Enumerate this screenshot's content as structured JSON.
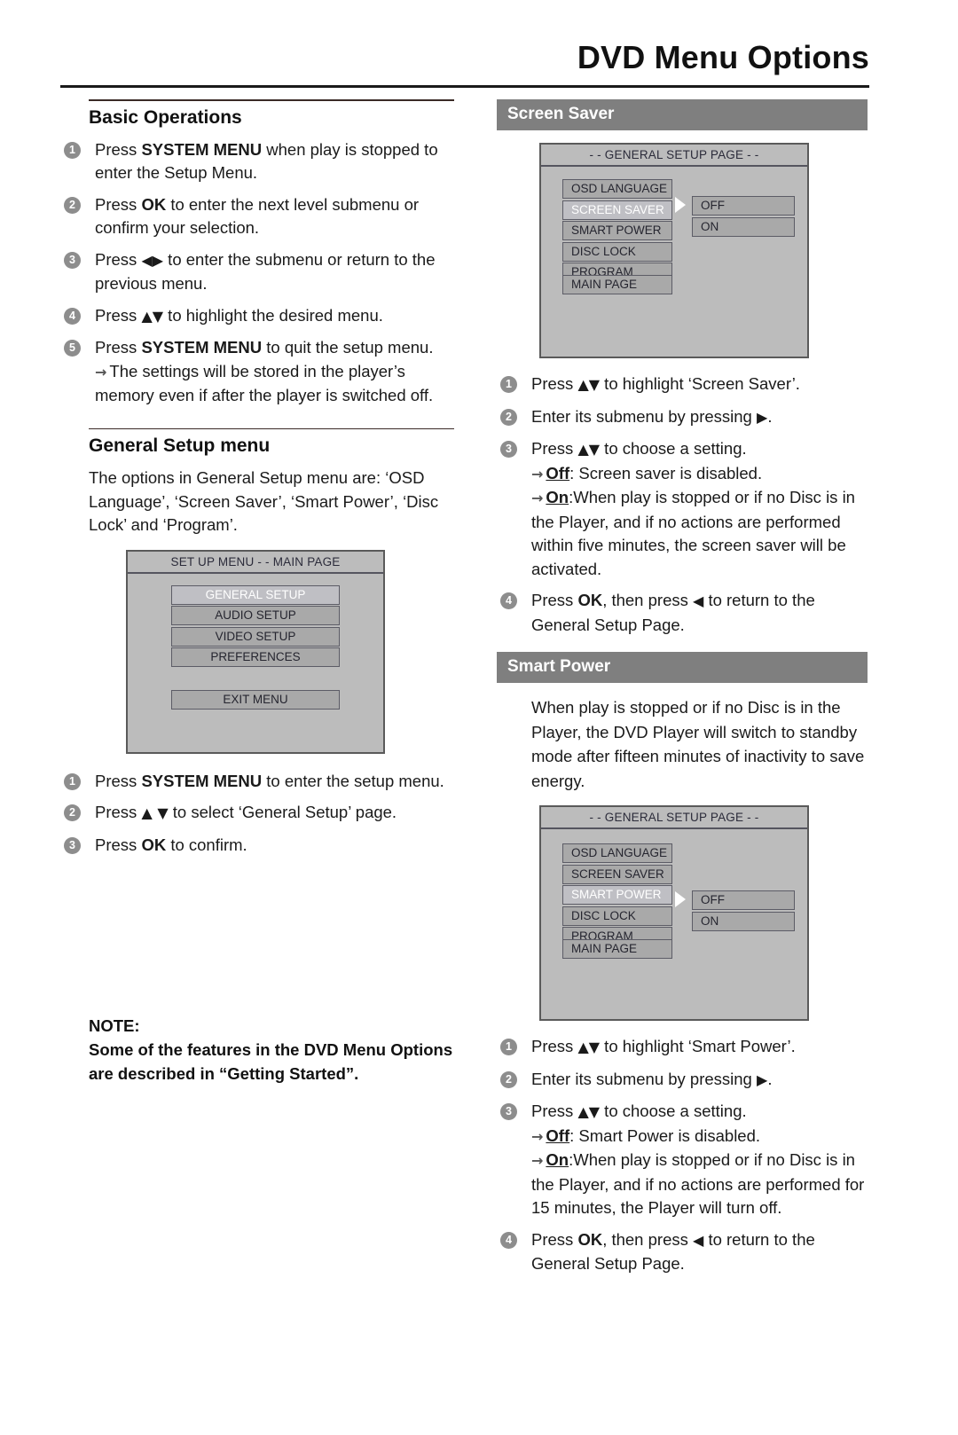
{
  "header": {
    "title": "DVD Menu Options"
  },
  "left": {
    "basic_ops": {
      "heading": "Basic Operations",
      "steps": [
        {
          "num": "1",
          "html_parts": [
            "Press ",
            "SYSTEM MENU",
            " when play is stopped to enter the Setup Menu."
          ]
        },
        {
          "num": "2",
          "html_parts": [
            "Press ",
            "OK",
            " to enter the next level submenu or confirm your selection."
          ]
        },
        {
          "num": "3",
          "html_parts": [
            "Press ",
            "◀▶",
            " to enter the submenu or return to the previous menu."
          ]
        },
        {
          "num": "4",
          "html_parts": [
            "Press ",
            "▲▼",
            " to highlight the desired menu."
          ]
        },
        {
          "num": "5",
          "html_parts": [
            "Press ",
            "SYSTEM MENU",
            " to quit the setup menu."
          ]
        }
      ],
      "step1_text_a": "Press ",
      "step1_bold": "SYSTEM MENU",
      "step1_text_b": " when play is stopped to enter the Setup Menu.",
      "step2_text_a": "Press ",
      "step2_bold": "OK",
      "step2_text_b": " to enter the next level submenu or confirm your selection.",
      "step3_text_a": "Press ",
      "step3_arrows": "◀▶",
      "step3_text_b": " to enter the submenu or return to the previous menu.",
      "step4_text_a": "Press ",
      "step4_arrows": "▲▼",
      "step4_text_b": " to highlight the desired menu.",
      "step5_text_a": "Press ",
      "step5_bold": "SYSTEM MENU",
      "step5_text_b": " to quit the setup menu.",
      "step5_sub": "The settings will be stored in the player’s memory even if after the player is switched off."
    },
    "general_setup": {
      "heading": "General Setup menu",
      "intro": "The options in General Setup menu are: ‘OSD Language’, ‘Screen Saver’, ‘Smart Power’, ‘Disc Lock’ and ‘Program’.",
      "steps": {
        "s1_a": "Press ",
        "s1_bold": "SYSTEM MENU",
        "s1_b": " to enter the setup menu.",
        "s2_a": "Press ",
        "s2_arrows": "▲ ▼",
        "s2_b": " to select ‘General Setup’ page.",
        "s3_a": "Press ",
        "s3_bold": "OK",
        "s3_b": " to confirm."
      }
    },
    "osd_main": {
      "title": "SET UP MENU - - MAIN PAGE",
      "items": [
        "GENERAL SETUP",
        "AUDIO SETUP",
        "VIDEO SETUP",
        "PREFERENCES"
      ],
      "selected_index": 0,
      "exit_label": "EXIT MENU"
    },
    "note": {
      "label": "NOTE:",
      "body": "Some of the features in the DVD Menu Options are described in “Getting Started”."
    }
  },
  "right": {
    "screen_saver": {
      "banner": "Screen Saver",
      "osd": {
        "title": "- - GENERAL SETUP PAGE - -",
        "items": [
          "OSD LANGUAGE",
          "SCREEN SAVER",
          "SMART POWER",
          "DISC LOCK",
          "PROGRAM"
        ],
        "selected_index": 1,
        "main_page_label": "MAIN PAGE",
        "options": [
          "OFF",
          "ON"
        ]
      },
      "steps": {
        "s1_a": "Press ",
        "s1_arrows": "▲▼",
        "s1_b": " to highlight ‘Screen Saver’.",
        "s2_a": "Enter its submenu by pressing ",
        "s2_arrow": "▶",
        "s2_b": ".",
        "s3_a": "Press ",
        "s3_arrows": "▲▼",
        "s3_b": " to choose a setting.",
        "s3_off_label": "Off",
        "s3_off_text": ": Screen saver is disabled.",
        "s3_on_label": "On",
        "s3_on_text": ":When play is stopped or if no Disc is in the Player, and if no actions are performed within five minutes, the screen saver will be activated.",
        "s4_a": "Press ",
        "s4_bold": "OK",
        "s4_b": ", then press ",
        "s4_arrow": "◀",
        "s4_c": " to return to the General Setup Page."
      }
    },
    "smart_power": {
      "banner": "Smart Power",
      "intro": "When play is stopped or if no Disc is in the Player, the DVD Player will switch to standby mode after fifteen minutes of inactivity to save energy.",
      "osd": {
        "title": "- - GENERAL SETUP PAGE - -",
        "items": [
          "OSD LANGUAGE",
          "SCREEN SAVER",
          "SMART POWER",
          "DISC LOCK",
          "PROGRAM"
        ],
        "selected_index": 2,
        "main_page_label": "MAIN PAGE",
        "options": [
          "OFF",
          "ON"
        ]
      },
      "steps": {
        "s1_a": "Press ",
        "s1_arrows": "▲▼",
        "s1_b": " to highlight ‘Smart Power’.",
        "s2_a": "Enter its submenu by pressing ",
        "s2_arrow": "▶",
        "s2_b": ".",
        "s3_a": "Press ",
        "s3_arrows": "▲▼",
        "s3_b": " to choose a setting.",
        "s3_off_label": "Off",
        "s3_off_text": ": Smart Power is disabled.",
        "s3_on_label": "On",
        "s3_on_text": ":When play is stopped or if no Disc is in the Player, and if no actions are performed for 15 minutes, the Player will turn off.",
        "s4_a": "Press ",
        "s4_bold": "OK",
        "s4_b": ", then press ",
        "s4_arrow": "◀",
        "s4_c": " to return to the General Setup Page."
      }
    }
  },
  "step_numbers": [
    "1",
    "2",
    "3",
    "4",
    "5"
  ],
  "arrow_bullet": "→",
  "colors": {
    "banner_bg": "#7f7f7f",
    "osd_bg": "#bcbcbc",
    "osd_button": "#a9a9a9",
    "step_circle": "#8d8d8d"
  }
}
